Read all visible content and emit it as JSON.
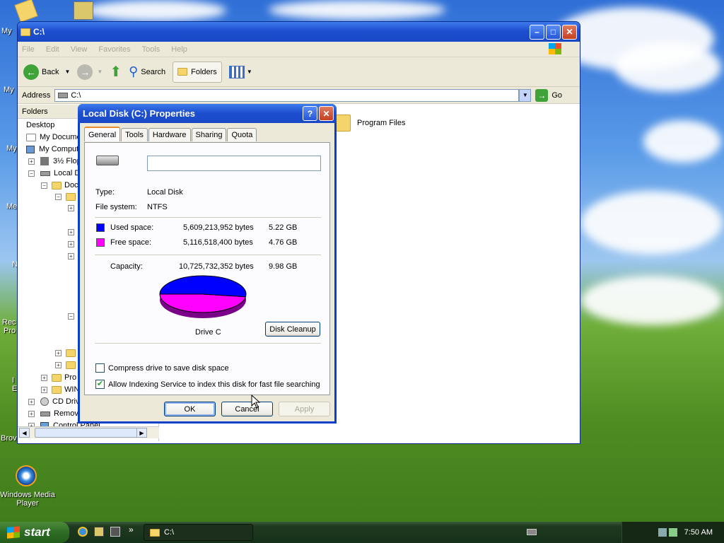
{
  "colors": {
    "used": "#0000ff",
    "free": "#ff00ff",
    "accent": "#1e4fd0"
  },
  "desktop": {
    "icons": [
      {
        "label": "My"
      },
      {
        "label": "My"
      },
      {
        "label": "My"
      },
      {
        "label": "Me"
      },
      {
        "label": "N"
      },
      {
        "label": "Rec"
      },
      {
        "label": "Pro"
      },
      {
        "label": "I"
      },
      {
        "label": "E"
      },
      {
        "label": "Brov"
      }
    ],
    "wmp": {
      "label": "Windows Media Player",
      "icon": "media-player-icon"
    }
  },
  "explorer": {
    "title": "C:\\",
    "menu": [
      "File",
      "Edit",
      "View",
      "Favorites",
      "Tools",
      "Help"
    ],
    "toolbar": {
      "back": "Back",
      "search": "Search",
      "folders": "Folders"
    },
    "address": {
      "label": "Address",
      "value": "C:\\",
      "go": "Go"
    },
    "folders_pane": {
      "heading": "Folders"
    },
    "tree": [
      "Desktop",
      "My Docume",
      "My Comput",
      "3½ Flop",
      "Local Di",
      "Doc",
      "Pro",
      "WIN",
      "CD Driv",
      "Remova",
      "Control Panel"
    ],
    "content": {
      "folder": "Program Files"
    }
  },
  "dialog": {
    "title": "Local Disk (C:) Properties",
    "tabs": [
      "General",
      "Tools",
      "Hardware",
      "Sharing",
      "Quota"
    ],
    "name_value": "",
    "type_label": "Type:",
    "type_value": "Local Disk",
    "fs_label": "File system:",
    "fs_value": "NTFS",
    "used": {
      "label": "Used space:",
      "bytes": "5,609,213,952 bytes",
      "gb": "5.22 GB"
    },
    "free": {
      "label": "Free space:",
      "bytes": "5,116,518,400 bytes",
      "gb": "4.76 GB"
    },
    "capacity": {
      "label": "Capacity:",
      "bytes": "10,725,732,352 bytes",
      "gb": "9.98 GB"
    },
    "drive_label": "Drive C",
    "used_fraction": 0.523,
    "cleanup": "Disk Cleanup",
    "compress": {
      "label": "Compress drive to save disk space",
      "checked": false
    },
    "indexing": {
      "label": "Allow Indexing Service to index this disk for fast file searching",
      "checked": true
    },
    "buttons": {
      "ok": "OK",
      "cancel": "Cancel",
      "apply": "Apply"
    }
  },
  "taskbar": {
    "start": "start",
    "task": "C:\\",
    "time": "7:50 AM",
    "more": "»"
  }
}
